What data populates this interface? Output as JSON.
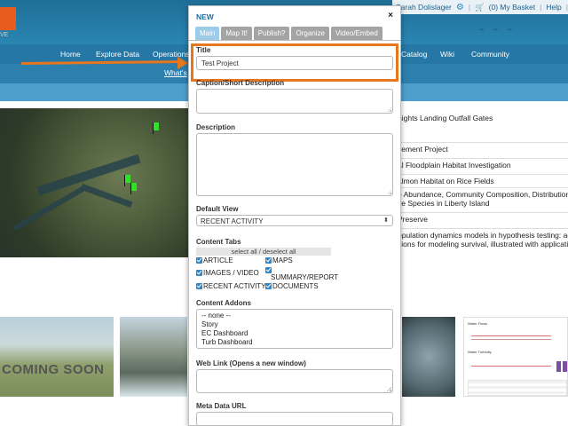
{
  "header": {
    "user_name": "Sarah Dolislager",
    "basket": "(0) My Basket",
    "help": "Help",
    "logo_sub": "VE"
  },
  "nav": {
    "items": [
      "Home",
      "Explore Data",
      "Operations",
      "Catalog",
      "Wiki",
      "Community"
    ],
    "sub_link": "What's"
  },
  "projects": [
    "nights Landing Outfall Gates",
    "vement Project",
    "al Floodplain Habitat Investigation",
    "almon Habitat on Rice Fields",
    "e Abundance, Community Composition, Distribution, Av",
    "ve Species in Liberty Island",
    "Preserve",
    "opulation dynamics models in hypothesis testing: advan",
    "sions for modeling survival, illustrated with application",
    ")"
  ],
  "thumbs": {
    "coming_soon": "COMING SOON",
    "mini_title_1": "Water Flows",
    "mini_title_2": "Water Turbidity"
  },
  "modal": {
    "title": "NEW",
    "close": "×",
    "tabs": [
      "Main",
      "Map It!",
      "Publish?",
      "Organize",
      "Video/Embed"
    ],
    "fields": {
      "title_label": "Title",
      "title_value": "Test Project",
      "caption_label": "Caption/Short Description",
      "description_label": "Description",
      "default_view_label": "Default View",
      "default_view_value": "RECENT ACTIVITY",
      "content_tabs_label": "Content Tabs",
      "select_all": "select all / deselect all",
      "checkboxes": {
        "article": "ARTICLE",
        "maps": "MAPS",
        "images_video": "IMAGES / VIDEO",
        "summary_report": "SUMMARY/REPORT",
        "recent_activity": "RECENT ACTIVITY",
        "documents": "DOCUMENTS"
      },
      "content_addons_label": "Content Addons",
      "addons": [
        "-- none --",
        "Story",
        "EC Dashboard",
        "Turb Dashboard"
      ],
      "web_link_label": "Web Link (Opens a new window)",
      "meta_url_label": "Meta Data URL"
    }
  },
  "colors": {
    "accent": "#e8761d",
    "header_blue": "#2577a5",
    "tab_active": "#9ecbe7",
    "checkbox_blue": "#2e86c8"
  }
}
